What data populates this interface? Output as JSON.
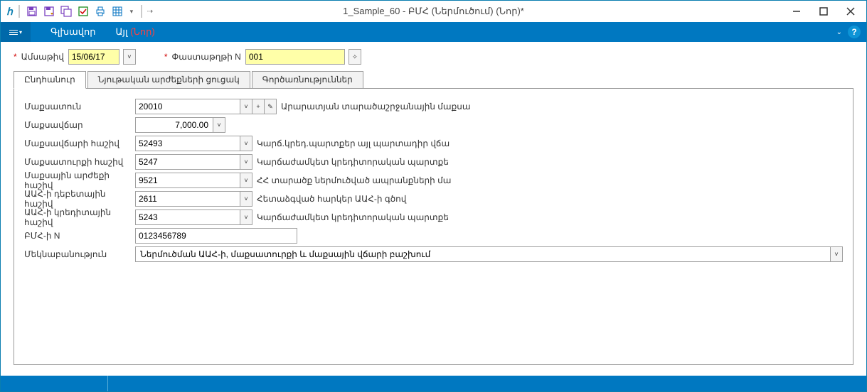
{
  "window": {
    "title": "1_Sample_60 - ԲՄՀ (Ներմուծում) (Նոր)*"
  },
  "menu": {
    "item1": "Գլխավոր",
    "item2_prefix": "Այլ ",
    "item2_new": "(Նոր)"
  },
  "header": {
    "date_label": "Ամսաթիվ",
    "date_value": "15/06/17",
    "doc_label": "Փաստաթղթի N",
    "doc_value": "001"
  },
  "tabs": {
    "t1": "Ընդհանուր",
    "t2": "Նյութական արժեքների ցուցակ",
    "t3": "Գործառնություններ"
  },
  "form": {
    "row1": {
      "label": "Մաքսատուն",
      "code": "20010",
      "desc": "Արարատյան տարածաշրջանային մաքսա"
    },
    "row2": {
      "label": "Մաքսավճար",
      "value": "7,000.00"
    },
    "row3": {
      "label": "Մաքսավճարի հաշիվ",
      "code": "52493",
      "desc": "Կարճ.կրեդ.պարտքեր այլ պարտադիր վճա"
    },
    "row4": {
      "label": "Մաքսատուրքի հաշիվ",
      "code": "5247",
      "desc": "Կարճաժամկետ կրեդիտորական պարտքե"
    },
    "row5": {
      "label": "Մաքսային արժեքի հաշիվ",
      "code": "9521",
      "desc": "ՀՀ տարածք ներմուծված ապրանքների մա"
    },
    "row6": {
      "label": "ԱԱՀ-ի դեբետային հաշիվ",
      "code": "2611",
      "desc": "Հետաձգված հարկեր ԱԱՀ-ի գծով"
    },
    "row7": {
      "label": "ԱԱՀ-ի կրեդիտային հաշիվ",
      "code": "5243",
      "desc": "Կարճաժամկետ կրեդիտորական պարտքե"
    },
    "row8": {
      "label": "ԲՄՀ-ի N",
      "value": "0123456789"
    },
    "row9": {
      "label": "Մեկնաբանություն",
      "value": "Ներմուծման ԱԱՀ-ի, մաքսատուրքի և մաքսային վճարի բաշխում"
    }
  },
  "icons": {
    "plus": "+",
    "pencil": "✎",
    "wand": "✧",
    "caret": "▾",
    "chev": "⌄",
    "dash": "—",
    "sq": "☐",
    "x": "✕"
  }
}
